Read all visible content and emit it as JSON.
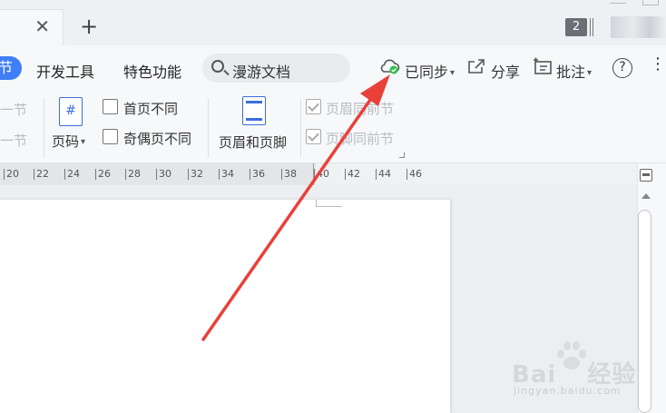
{
  "tabs": {
    "new_tab_glyph": "+"
  },
  "window": {
    "badge": "2"
  },
  "menu": {
    "active_partial": "节",
    "items": [
      "开发工具",
      "特色功能"
    ],
    "search_placeholder": "漫游文档",
    "sync_label": "已同步",
    "share_label": "分享",
    "comment_label": "批注",
    "help_label": "?",
    "more_label": "⋮"
  },
  "ribbon": {
    "faded_prev_1": "一节",
    "faded_prev_2": "一节",
    "page_number_icon_glyph": "#",
    "page_number_label": "页码",
    "first_page_diff": "首页不同",
    "odd_even_diff": "奇偶页不同",
    "header_footer_label": "页眉和页脚",
    "header_same_prev": "页眉同前节",
    "footer_same_prev": "页脚同前节"
  },
  "ruler": {
    "ticks": [
      "20",
      "22",
      "24",
      "26",
      "28",
      "30",
      "32",
      "34",
      "36",
      "38",
      "40",
      "42",
      "44",
      "46"
    ]
  },
  "watermark": {
    "brand": "Bai",
    "brand_cn": "经验",
    "url": "jingyan.baidu.com"
  },
  "colors": {
    "accent": "#3f7ef7",
    "arrow": "#e8413a",
    "sync_ok": "#2fbf4b"
  },
  "icons": {
    "tab_close": "close-icon",
    "cloud_sync": "cloud-check-icon",
    "share": "share-icon",
    "comment": "comment-icon",
    "search": "search-icon"
  }
}
